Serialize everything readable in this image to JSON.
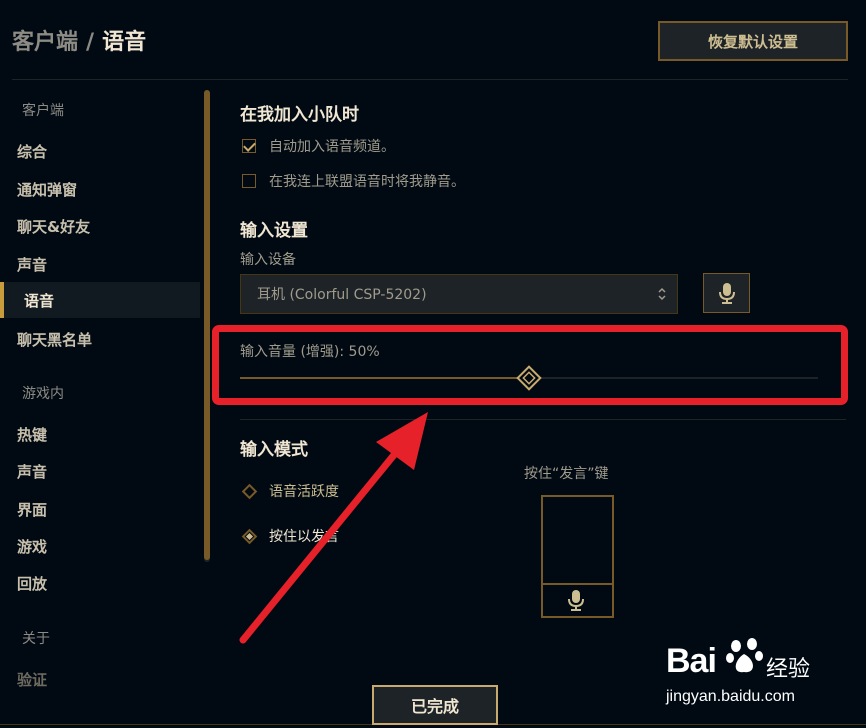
{
  "header": {
    "breadcrumb_parent": "客户端",
    "separator": "/",
    "title": "语音",
    "reset_button": "恢复默认设置"
  },
  "sidebar": {
    "section_client": "客户端",
    "client_items": [
      "综合",
      "通知弹窗",
      "聊天&好友",
      "声音",
      "语音",
      "聊天黑名单"
    ],
    "active_item": "语音",
    "section_ingame": "游戏内",
    "ingame_items": [
      "热键",
      "声音",
      "界面",
      "游戏",
      "回放"
    ],
    "section_about": "关于",
    "about_items": [
      "验证"
    ]
  },
  "party": {
    "title": "在我加入小队时",
    "auto_join": {
      "label": "自动加入语音频道。",
      "checked": true
    },
    "mute_on_connect": {
      "label": "在我连上联盟语音时将我静音。",
      "checked": false
    }
  },
  "input_settings": {
    "title": "输入设置",
    "device_label": "输入设备",
    "device_value": "耳机 (Colorful CSP-5202)",
    "volume_label": "输入音量 (增强): 50%",
    "volume_percent": 50
  },
  "input_mode": {
    "title": "输入模式",
    "options": [
      {
        "label": "语音活跃度",
        "selected": false
      },
      {
        "label": "按住以发言",
        "selected": true
      }
    ],
    "ptt_label": "按住“发言”键"
  },
  "footer": {
    "done_button": "已完成"
  },
  "watermark": {
    "brand": "Bai",
    "chinese": "经验",
    "url": "jingyan.baidu.com"
  },
  "colors": {
    "background": "#010a13",
    "gold": "#c8aa6e",
    "gold_dark": "#785a28",
    "annotation_red": "#e62129"
  }
}
